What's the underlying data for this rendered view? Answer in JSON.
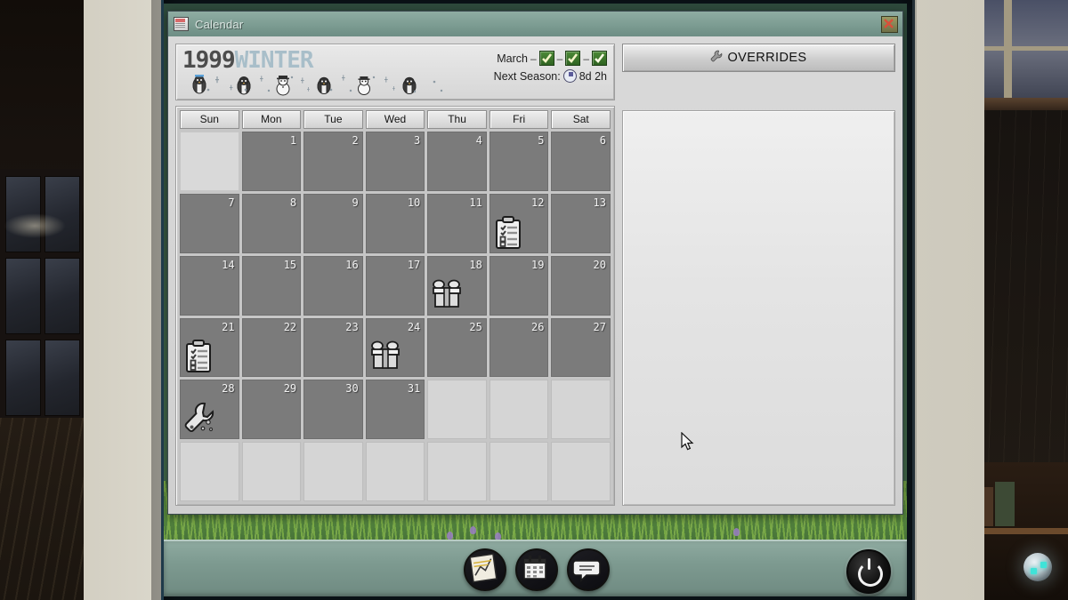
{
  "window": {
    "title": "Calendar",
    "app_icon": "calendar-app-icon",
    "close_icon": "close-icon"
  },
  "season_header": {
    "year": "1999",
    "season": "WINTER",
    "decoration": "penguins-and-snowmen",
    "month_label": "March",
    "month_checkboxes": [
      {
        "name": "month-check-1",
        "checked": true
      },
      {
        "name": "month-check-2",
        "checked": true
      },
      {
        "name": "month-check-3",
        "checked": true
      }
    ],
    "next_season_label": "Next Season:",
    "next_season_value": "8d 2h",
    "clock_icon": "clock-icon",
    "separator": "–"
  },
  "calendar": {
    "weekday_headers": [
      "Sun",
      "Mon",
      "Tue",
      "Wed",
      "Thu",
      "Fri",
      "Sat"
    ],
    "weeks": [
      [
        {
          "day": "",
          "state": "blank",
          "event": ""
        },
        {
          "day": "1",
          "state": "past",
          "event": ""
        },
        {
          "day": "2",
          "state": "past",
          "event": ""
        },
        {
          "day": "3",
          "state": "past",
          "event": ""
        },
        {
          "day": "4",
          "state": "past",
          "event": ""
        },
        {
          "day": "5",
          "state": "past",
          "event": ""
        },
        {
          "day": "6",
          "state": "past",
          "event": ""
        }
      ],
      [
        {
          "day": "7",
          "state": "past",
          "event": ""
        },
        {
          "day": "8",
          "state": "past",
          "event": ""
        },
        {
          "day": "9",
          "state": "past",
          "event": ""
        },
        {
          "day": "10",
          "state": "past",
          "event": ""
        },
        {
          "day": "11",
          "state": "past",
          "event": ""
        },
        {
          "day": "12",
          "state": "past",
          "event": "clipboard"
        },
        {
          "day": "13",
          "state": "past",
          "event": ""
        }
      ],
      [
        {
          "day": "14",
          "state": "past",
          "event": ""
        },
        {
          "day": "15",
          "state": "past",
          "event": ""
        },
        {
          "day": "16",
          "state": "past",
          "event": ""
        },
        {
          "day": "17",
          "state": "past",
          "event": ""
        },
        {
          "day": "18",
          "state": "past",
          "event": "gift"
        },
        {
          "day": "19",
          "state": "past",
          "event": ""
        },
        {
          "day": "20",
          "state": "past",
          "event": ""
        }
      ],
      [
        {
          "day": "21",
          "state": "past",
          "event": "clipboard"
        },
        {
          "day": "22",
          "state": "past",
          "event": ""
        },
        {
          "day": "23",
          "state": "past",
          "event": ""
        },
        {
          "day": "24",
          "state": "past",
          "event": "gift"
        },
        {
          "day": "25",
          "state": "past",
          "event": ""
        },
        {
          "day": "26",
          "state": "past",
          "event": ""
        },
        {
          "day": "27",
          "state": "past",
          "event": ""
        }
      ],
      [
        {
          "day": "28",
          "state": "past",
          "event": "wrench"
        },
        {
          "day": "29",
          "state": "past",
          "event": ""
        },
        {
          "day": "30",
          "state": "past",
          "event": ""
        },
        {
          "day": "31",
          "state": "past",
          "event": ""
        },
        {
          "day": "",
          "state": "empty",
          "event": ""
        },
        {
          "day": "",
          "state": "empty",
          "event": ""
        },
        {
          "day": "",
          "state": "empty",
          "event": ""
        }
      ],
      [
        {
          "day": "",
          "state": "empty",
          "event": ""
        },
        {
          "day": "",
          "state": "empty",
          "event": ""
        },
        {
          "day": "",
          "state": "empty",
          "event": ""
        },
        {
          "day": "",
          "state": "empty",
          "event": ""
        },
        {
          "day": "",
          "state": "empty",
          "event": ""
        },
        {
          "day": "",
          "state": "empty",
          "event": ""
        },
        {
          "day": "",
          "state": "empty",
          "event": ""
        }
      ]
    ]
  },
  "overrides": {
    "button_label": "OVERRIDES",
    "button_icon": "wrench-icon",
    "panel_content": ""
  },
  "taskbar": {
    "items": [
      {
        "name": "taskbar-chart-icon",
        "icon": "chart-icon"
      },
      {
        "name": "taskbar-calendar-icon",
        "icon": "calendar-icon"
      },
      {
        "name": "taskbar-chat-icon",
        "icon": "speech-bubble-icon"
      }
    ],
    "power_button": "power-icon"
  },
  "colors": {
    "titlebar": "#7c9c92",
    "taskbar": "#7d9a90",
    "checkbox_green": "#3f7a28",
    "past_day": "#7b7b7b",
    "season_text": "#a8bec9",
    "year_text": "#4d4d4d"
  }
}
